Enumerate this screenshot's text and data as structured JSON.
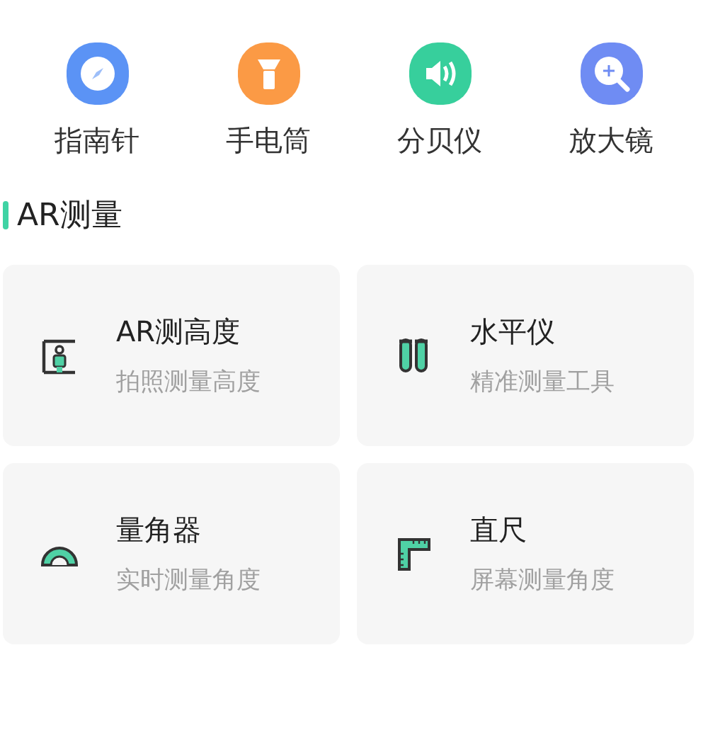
{
  "quick_tools": [
    {
      "label": "指南针",
      "kind": "compass",
      "color": "#5b93f5"
    },
    {
      "label": "手电筒",
      "kind": "flashlight",
      "color": "#fb9a45"
    },
    {
      "label": "分贝仪",
      "kind": "speaker",
      "color": "#37cf9c"
    },
    {
      "label": "放大镜",
      "kind": "magnifier",
      "color": "#6f8cf3"
    }
  ],
  "section": {
    "title": "AR测量"
  },
  "cards": [
    {
      "title": "AR测高度",
      "subtitle": "拍照测量高度",
      "kind": "height"
    },
    {
      "title": "水平仪",
      "subtitle": "精准测量工具",
      "kind": "level"
    },
    {
      "title": "量角器",
      "subtitle": "实时测量角度",
      "kind": "protractor"
    },
    {
      "title": "直尺",
      "subtitle": "屏幕测量角度",
      "kind": "ruler"
    }
  ]
}
